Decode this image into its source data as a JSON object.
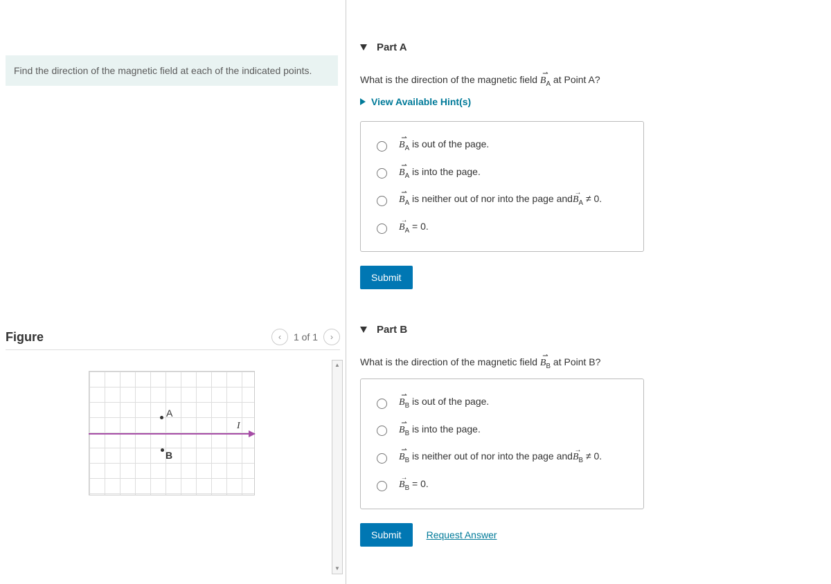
{
  "left": {
    "prompt": "Find the direction of the magnetic field at each of the indicated points.",
    "figure_title": "Figure",
    "pager": "1 of 1",
    "points": {
      "A": "A",
      "B": "B",
      "I": "I"
    }
  },
  "partA": {
    "title": "Part A",
    "question_pre": "What is the direction of the magnetic field ",
    "question_post": " at Point A?",
    "hints": "View Available Hint(s)",
    "opt1_post": " is out of the page.",
    "opt2_post": " is into the page.",
    "opt3_mid": " is neither out of nor into the page and",
    "opt3_post": " ≠ 0.",
    "opt4_post": " = 0.",
    "submit": "Submit"
  },
  "partB": {
    "title": "Part B",
    "question_pre": "What is the direction of the magnetic field ",
    "question_post": " at Point B?",
    "opt1_post": " is out of the page.",
    "opt2_post": " is into the page.",
    "opt3_mid": " is neither out of nor into the page and",
    "opt3_post": " ≠ 0.",
    "opt4_post": " = 0.",
    "submit": "Submit",
    "request": "Request Answer"
  },
  "symbols": {
    "BA_html": "<span class='vec'><span class='arrow'>⇀</span>B<span class='sub'>A</span></span>",
    "BB_html": "<span class='vec'><span class='arrow'>⇀</span>B<span class='sub'>B</span></span>"
  }
}
